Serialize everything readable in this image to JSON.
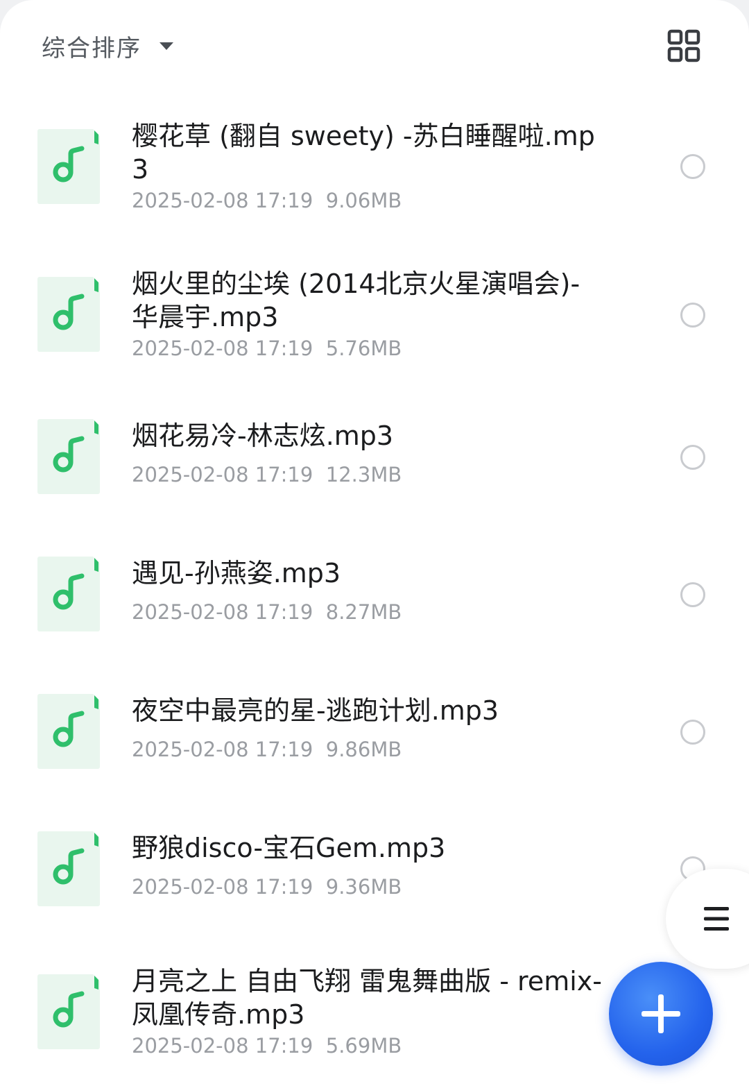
{
  "sort": {
    "label": "综合排序",
    "caret_icon": "caret-down-icon"
  },
  "view_toggle": {
    "icon": "grid-view-icon"
  },
  "colors": {
    "accent": "#2f6ff0",
    "music_green": "#2fbf6b",
    "thumb_bg": "#e9f6ee"
  },
  "files": [
    {
      "name": "樱花草 (翻自 sweety) -苏白睡醒啦.mp3",
      "date": "2025-02-08 17:19",
      "size": "9.06MB",
      "selected": false
    },
    {
      "name": "烟火里的尘埃 (2014北京火星演唱会)-华晨宇.mp3",
      "date": "2025-02-08 17:19",
      "size": "5.76MB",
      "selected": false
    },
    {
      "name": "烟花易冷-林志炫.mp3",
      "date": "2025-02-08 17:19",
      "size": "12.3MB",
      "selected": false
    },
    {
      "name": "遇见-孙燕姿.mp3",
      "date": "2025-02-08 17:19",
      "size": "8.27MB",
      "selected": false
    },
    {
      "name": "夜空中最亮的星-逃跑计划.mp3",
      "date": "2025-02-08 17:19",
      "size": "9.86MB",
      "selected": false
    },
    {
      "name": "野狼disco-宝石Gem.mp3",
      "date": "2025-02-08 17:19",
      "size": "9.36MB",
      "selected": false
    },
    {
      "name": "月亮之上 自由飞翔 雷鬼舞曲版 - remix-凤凰传奇.mp3",
      "date": "2025-02-08 17:19",
      "size": "5.69MB",
      "selected": false
    }
  ],
  "side_menu": {
    "icon": "menu-icon"
  },
  "fab": {
    "icon": "plus-icon"
  }
}
